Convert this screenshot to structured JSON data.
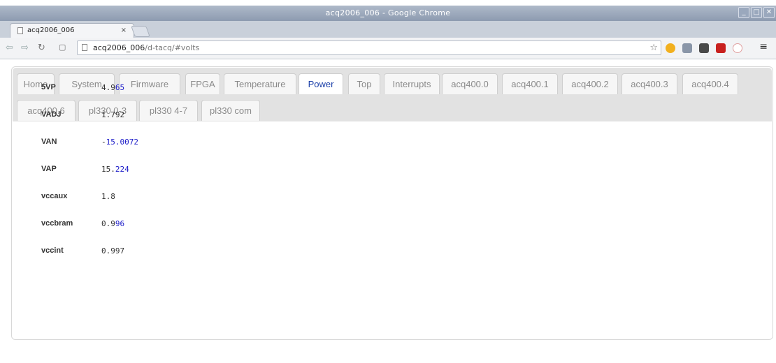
{
  "window": {
    "title": "acq2006_006 - Google Chrome"
  },
  "browser": {
    "tab_label": "acq2006_006",
    "tab_close": "×",
    "url_host": "acq2006_006",
    "url_path": "/d-tacq/#volts"
  },
  "tabs_row1": [
    "Home",
    "System",
    "Firmware",
    "FPGA",
    "Temperature",
    "Power",
    "Top",
    "Interrupts",
    "acq400.0",
    "acq400.1",
    "acq400.2",
    "acq400.3",
    "acq400.4"
  ],
  "tabs_row2": [
    "acq400.6",
    "pl330 0-3",
    "pl330 4-7",
    "pl330 com"
  ],
  "active_tab": "Power",
  "readings": [
    {
      "name": "5VP",
      "value_plain": "4.9",
      "value_changed": "65"
    },
    {
      "name": "VADJ",
      "value_plain": "1.792",
      "value_changed": ""
    },
    {
      "name": "VAN",
      "value_plain": "-",
      "value_changed": "15.0072"
    },
    {
      "name": "VAP",
      "value_plain": "15.",
      "value_changed": "224"
    },
    {
      "name": "vccaux",
      "value_plain": "1.8",
      "value_changed": ""
    },
    {
      "name": "vccbram",
      "value_plain": "0.9",
      "value_changed": "96"
    },
    {
      "name": "vccint",
      "value_plain": "0.997",
      "value_changed": ""
    }
  ],
  "colors": {
    "active_tab_text": "#1a3ea8",
    "changed_digits": "#1a1ac8"
  }
}
